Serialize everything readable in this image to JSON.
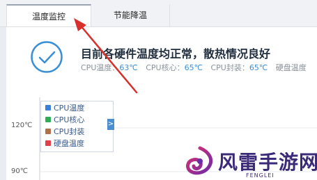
{
  "tabs": [
    {
      "label": "温度监控",
      "active": true
    },
    {
      "label": "节能降温",
      "active": false
    }
  ],
  "status": {
    "headline": "目前各硬件温度均正常，散热情况良好",
    "metrics": [
      {
        "label": "CPU温度：",
        "value": "63℃"
      },
      {
        "label": "CPU核心：",
        "value": "65℃"
      },
      {
        "label": "CPU封装：",
        "value": "65℃"
      },
      {
        "label": "硬盘温度",
        "value": ""
      }
    ]
  },
  "chart": {
    "y_ticks": [
      "120℃",
      "90℃"
    ],
    "legend_toggle": ">",
    "legend": [
      {
        "label": "CPU温度",
        "color": "#3b7fd9"
      },
      {
        "label": "CPU核心",
        "color": "#2fae5a"
      },
      {
        "label": "CPU封装",
        "color": "#b0704a"
      },
      {
        "label": "硬盘温度",
        "color": "#e0404a"
      }
    ]
  },
  "watermark": {
    "brand": "风雷手游网",
    "sub": "FENGLEI"
  },
  "colors": {
    "accent": "#3a8fd6",
    "annotation_arrow": "#d8312b",
    "watermark": "#3b2a78"
  }
}
